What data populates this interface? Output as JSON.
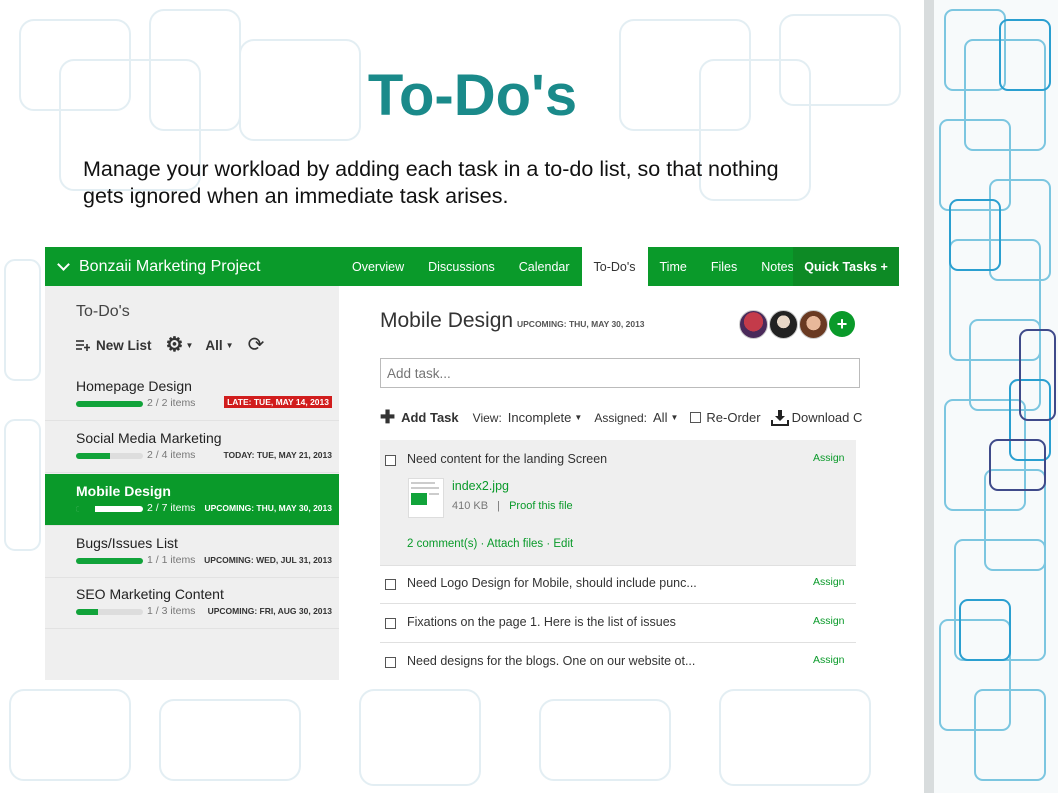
{
  "slide": {
    "title": "To-Do's",
    "description": "Manage your workload by adding each task in a to-do list, so that nothing gets ignored when an immediate task arises."
  },
  "app": {
    "project_name": "Bonzaii Marketing Project",
    "nav_tabs": [
      "Overview",
      "Discussions",
      "Calendar",
      "To-Do's",
      "Time",
      "Files",
      "Notes"
    ],
    "active_tab": "To-Do's",
    "quick_tasks": "Quick Tasks +",
    "accent_color": "#0a9a2a",
    "late_color": "#d11d1d",
    "sidebar": {
      "title": "To-Do's",
      "new_list": "New List",
      "filter": "All",
      "lists": [
        {
          "name": "Homepage Design",
          "count": "2 / 2 items",
          "progress": 1.0,
          "due": "LATE: TUE, MAY 14, 2013",
          "late": true,
          "active": false
        },
        {
          "name": "Social Media Marketing",
          "count": "2 / 4 items",
          "progress": 0.5,
          "due": "TODAY: TUE, MAY 21, 2013",
          "late": false,
          "active": false
        },
        {
          "name": "Mobile Design",
          "count": "2 / 7 items",
          "progress": 0.29,
          "due": "UPCOMING: THU, MAY 30, 2013",
          "late": false,
          "active": true
        },
        {
          "name": "Bugs/Issues List",
          "count": "1 / 1 items",
          "progress": 1.0,
          "due": "UPCOMING: WED, JUL 31, 2013",
          "late": false,
          "active": false
        },
        {
          "name": "SEO Marketing Content",
          "count": "1 / 3 items",
          "progress": 0.33,
          "due": "UPCOMING: FRI, AUG 30, 2013",
          "late": false,
          "active": false
        }
      ]
    },
    "main": {
      "list_title": "Mobile Design",
      "upcoming": "UPCOMING: THU, MAY 30, 2013",
      "add_member": "+",
      "add_task_placeholder": "Add task...",
      "add_task_label": "Add Task",
      "view_label": "View:",
      "view_value": "Incomplete",
      "assigned_label": "Assigned:",
      "assigned_value": "All",
      "reorder_label": "Re-Order",
      "download_label": "Download C",
      "tasks": [
        {
          "text": "Need content for the landing Screen",
          "assign": "Assign"
        },
        {
          "text": "Need Logo Design for Mobile, should include punc...",
          "assign": "Assign"
        },
        {
          "text": "Fixations on the page 1. Here is the list of issues",
          "assign": "Assign"
        },
        {
          "text": "Need designs for the blogs. One on our website ot...",
          "assign": "Assign"
        }
      ],
      "attachment": {
        "file_name": "index2.jpg",
        "file_size": "410 KB",
        "separator": "|",
        "proof_link": "Proof this file",
        "comments": "2 comment(s)",
        "attach_files": "Attach files",
        "edit": "Edit"
      }
    }
  }
}
